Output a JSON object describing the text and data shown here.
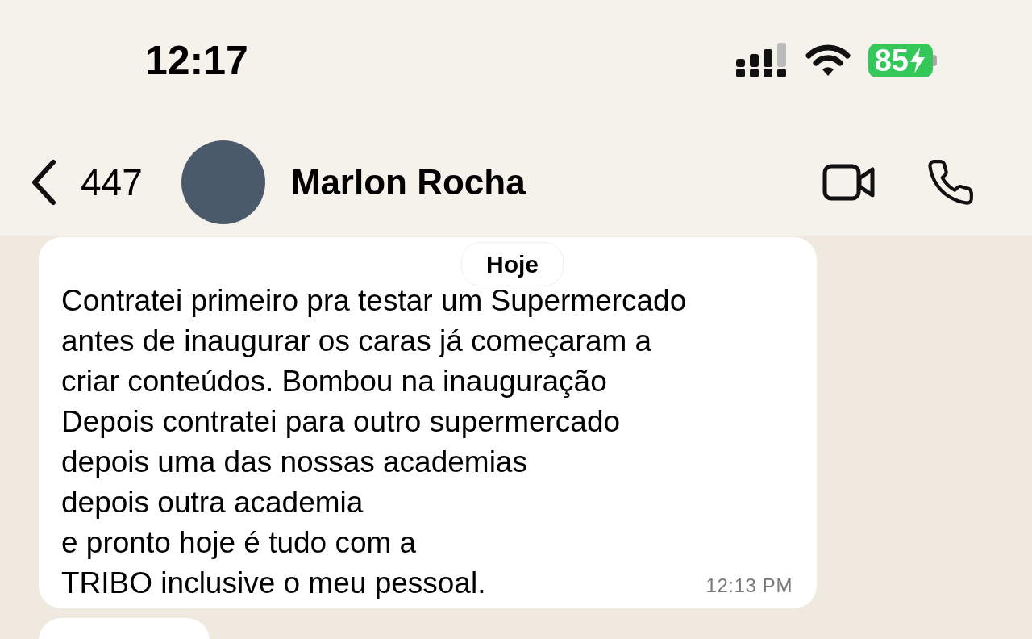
{
  "status_bar": {
    "time": "12:17",
    "battery": "85"
  },
  "header": {
    "back_count": "447",
    "contact_name": "Marlon Rocha"
  },
  "date_chip": "Hoje",
  "messages": [
    {
      "text": "Contratei primeiro pra testar um Supermercado\nantes de inaugurar os caras já começaram a\ncriar conteúdos. Bombou na inauguração\nDepois contratei para outro supermercado\ndepois uma das nossas academias\ndepois outra academia\ne pronto hoje é tudo com a\nTRIBO inclusive o meu pessoal.",
      "time": "12:13 PM"
    }
  ]
}
